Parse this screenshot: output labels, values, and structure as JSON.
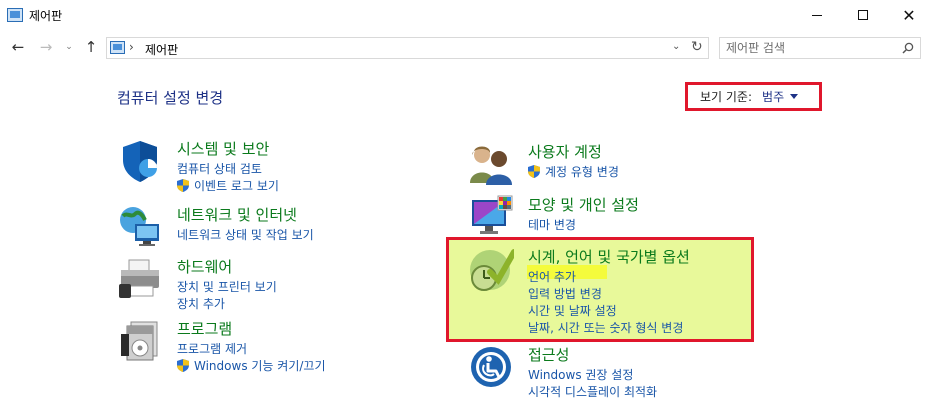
{
  "window": {
    "title": "제어판",
    "controls": {
      "minimize": "minimize",
      "maximize": "maximize",
      "close": "✕"
    }
  },
  "nav": {
    "back": "←",
    "forward": "→",
    "recent": "⌄",
    "up": "↑",
    "address_separator": "›",
    "breadcrumb": "제어판",
    "dropdown": "⌄",
    "refresh": "↻"
  },
  "search": {
    "placeholder": "제어판 검색"
  },
  "main": {
    "title": "컴퓨터 설정 변경",
    "view_by": {
      "label": "보기 기준:",
      "value": "범주"
    }
  },
  "categories_left": [
    {
      "title": "시스템 및 보안",
      "icon": "shield-icon",
      "links": [
        {
          "text": "컴퓨터 상태 검토",
          "shield": false
        },
        {
          "text": "이벤트 로그 보기",
          "shield": true
        }
      ]
    },
    {
      "title": "네트워크 및 인터넷",
      "icon": "network-icon",
      "links": [
        {
          "text": "네트워크 상태 및 작업 보기",
          "shield": false
        }
      ]
    },
    {
      "title": "하드웨어",
      "icon": "printer-icon",
      "links": [
        {
          "text": "장치 및 프린터 보기",
          "shield": false
        },
        {
          "text": "장치 추가",
          "shield": false
        }
      ]
    },
    {
      "title": "프로그램",
      "icon": "programs-icon",
      "links": [
        {
          "text": "프로그램 제거",
          "shield": false
        },
        {
          "text": "Windows 기능 켜기/끄기",
          "shield": true
        }
      ]
    }
  ],
  "categories_right": [
    {
      "title": "사용자 계정",
      "icon": "users-icon",
      "links": [
        {
          "text": "계정 유형 변경",
          "shield": true
        }
      ]
    },
    {
      "title": "모양 및 개인 설정",
      "icon": "display-icon",
      "links": [
        {
          "text": "테마 변경",
          "shield": false
        }
      ]
    },
    {
      "title": "시계, 언어 및 국가별 옵션",
      "icon": "clock-globe-icon",
      "links": [
        {
          "text": "언어 추가",
          "shield": false
        },
        {
          "text": "입력 방법 변경",
          "shield": false
        },
        {
          "text": "시간 및 날짜 설정",
          "shield": false
        },
        {
          "text": "날짜, 시간 또는 숫자 형식 변경",
          "shield": false
        }
      ]
    },
    {
      "title": "접근성",
      "icon": "accessibility-icon",
      "links": [
        {
          "text": "Windows 권장 설정",
          "shield": false
        },
        {
          "text": "시각적 디스플레이 최적화",
          "shield": false
        }
      ]
    }
  ],
  "colors": {
    "category_title": "#0b7a1c",
    "link": "#1a56a8",
    "page_title": "#1e3287",
    "annotation_border": "#e0172c",
    "highlight_fill": "#e8f99a",
    "highlight_text": "#f4fb3c"
  }
}
